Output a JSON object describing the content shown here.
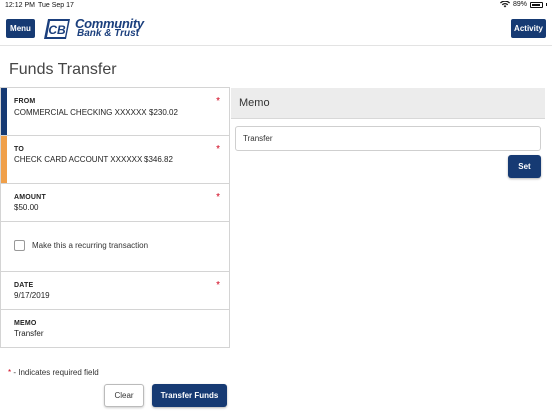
{
  "status_bar": {
    "time": "12:12 PM",
    "date": "Tue Sep 17",
    "battery": "89%",
    "battery_level": 0.89,
    "wifi_icon": "wifi-icon",
    "battery_icon": "battery-icon"
  },
  "header": {
    "menu_label": "Menu",
    "activity_label": "Activity",
    "logo_line1": "Community",
    "logo_line2": "Bank & Trust",
    "logo_mark": "CB"
  },
  "page": {
    "title": "Funds Transfer"
  },
  "form": {
    "from": {
      "label": "FROM",
      "account": "COMMERCIAL CHECKING XXXXXX",
      "balance": "$230.02",
      "required": "*",
      "stripe_color": "#163a73"
    },
    "to": {
      "label": "TO",
      "account": "CHECK CARD ACCOUNT XXXXXX",
      "balance": "$346.82",
      "required": "*",
      "stripe_color": "#f0a04a"
    },
    "amount": {
      "label": "AMOUNT",
      "value": "$50.00",
      "required": "*"
    },
    "recurring": {
      "label": "Make this a recurring transaction",
      "checked": false
    },
    "date": {
      "label": "DATE",
      "value": "9/17/2019",
      "required": "*"
    },
    "memo": {
      "label": "MEMO",
      "value": "Transfer"
    }
  },
  "memo_panel": {
    "title": "Memo",
    "input_value": "Transfer",
    "set_label": "Set"
  },
  "footer": {
    "required_star": "*",
    "required_note": " - Indicates required field",
    "clear_label": "Clear",
    "transfer_label": "Transfer Funds"
  },
  "colors": {
    "primary": "#163a73",
    "accent_orange": "#f0a04a",
    "required_red": "#d0021b"
  }
}
